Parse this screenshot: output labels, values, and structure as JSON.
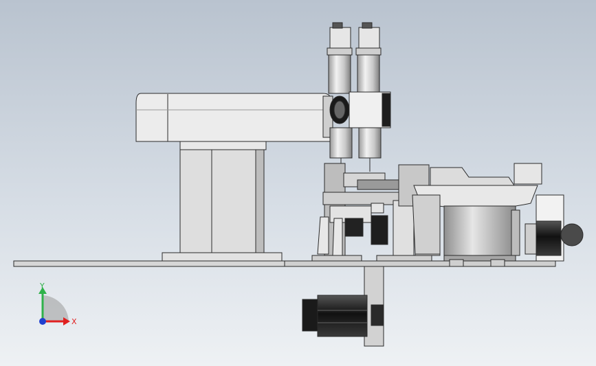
{
  "viewport": {
    "background_top": "#b9c3cf",
    "background_bottom": "#eef1f4",
    "model_colors": {
      "light_gray": "#d8d8d8",
      "mid_gray": "#a9a9a9",
      "dark": "#1e1e1e",
      "edge": "#2a2a2a"
    }
  },
  "triad": {
    "y_label": "Y",
    "x_label": "X",
    "y_color": "#2fb24a",
    "x_color": "#e02020",
    "z_color": "#2040d0"
  }
}
